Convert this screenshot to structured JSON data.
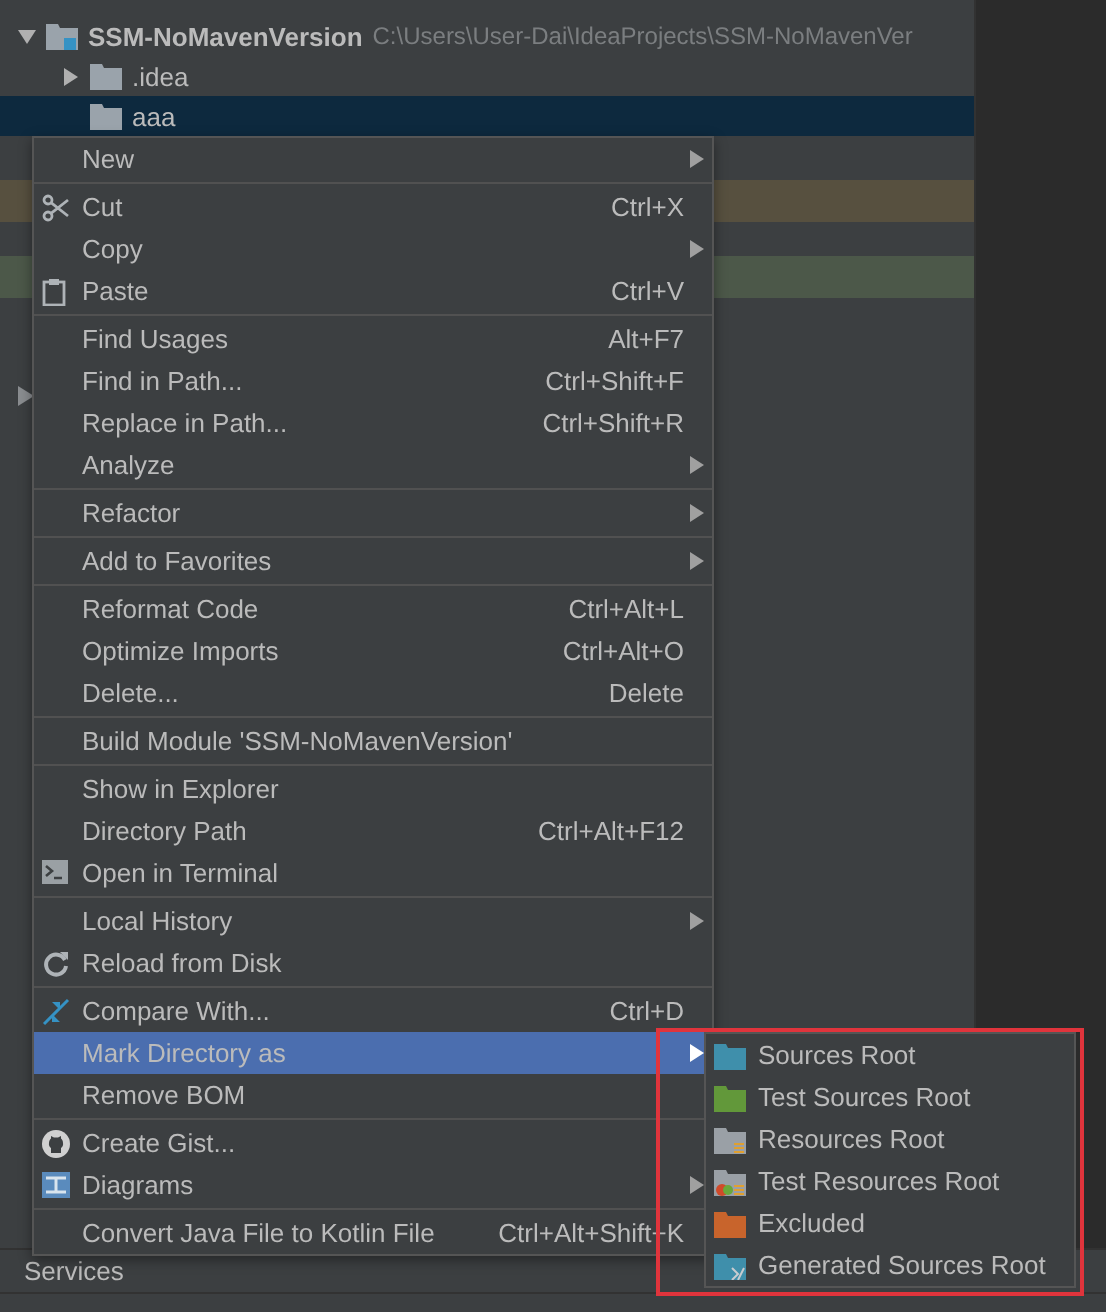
{
  "project_tree": {
    "items": [
      {
        "name": "SSM-NoMavenVersion",
        "path": "C:\\Users\\User-Dai\\IdeaProjects\\SSM-NoMavenVer",
        "expanded": true,
        "selected": false,
        "children": [
          {
            "name": ".idea",
            "expanded": false,
            "selected": false
          },
          {
            "name": "aaa",
            "selected": true
          }
        ]
      }
    ]
  },
  "context_menu": {
    "groups": [
      {
        "items": [
          {
            "label": "New",
            "submenu": true,
            "selected": false
          }
        ]
      },
      {
        "items": [
          {
            "label": "Cut",
            "shortcut": "Ctrl+X",
            "kind": "cut",
            "selected": false
          },
          {
            "label": "Copy",
            "submenu": true,
            "selected": false
          },
          {
            "label": "Paste",
            "shortcut": "Ctrl+V",
            "kind": "paste",
            "selected": false
          }
        ]
      },
      {
        "items": [
          {
            "label": "Find Usages",
            "shortcut": "Alt+F7",
            "selected": false
          },
          {
            "label": "Find in Path...",
            "shortcut": "Ctrl+Shift+F",
            "selected": false
          },
          {
            "label": "Replace in Path...",
            "shortcut": "Ctrl+Shift+R",
            "selected": false
          },
          {
            "label": "Analyze",
            "submenu": true,
            "selected": false
          }
        ]
      },
      {
        "items": [
          {
            "label": "Refactor",
            "submenu": true,
            "selected": false
          }
        ]
      },
      {
        "items": [
          {
            "label": "Add to Favorites",
            "submenu": true,
            "selected": false
          }
        ]
      },
      {
        "items": [
          {
            "label": "Reformat Code",
            "shortcut": "Ctrl+Alt+L",
            "selected": false
          },
          {
            "label": "Optimize Imports",
            "shortcut": "Ctrl+Alt+O",
            "selected": false
          },
          {
            "label": "Delete...",
            "shortcut": "Delete",
            "selected": false
          }
        ]
      },
      {
        "items": [
          {
            "label": "Build Module 'SSM-NoMavenVersion'",
            "selected": false
          }
        ]
      },
      {
        "items": [
          {
            "label": "Show in Explorer",
            "selected": false
          },
          {
            "label": "Directory Path",
            "shortcut": "Ctrl+Alt+F12",
            "selected": false
          },
          {
            "label": "Open in Terminal",
            "kind": "terminal",
            "selected": false
          }
        ]
      },
      {
        "items": [
          {
            "label": "Local History",
            "submenu": true,
            "selected": false
          },
          {
            "label": "Reload from Disk",
            "kind": "reload",
            "selected": false
          }
        ]
      },
      {
        "items": [
          {
            "label": "Compare With...",
            "shortcut": "Ctrl+D",
            "kind": "compare",
            "selected": false
          },
          {
            "label": "Mark Directory as",
            "submenu": true,
            "selected": true
          },
          {
            "label": "Remove BOM",
            "selected": false
          }
        ]
      },
      {
        "items": [
          {
            "label": "Create Gist...",
            "kind": "github",
            "selected": false
          },
          {
            "label": "Diagrams",
            "submenu": true,
            "kind": "diagram",
            "selected": false
          }
        ]
      },
      {
        "items": [
          {
            "label": "Convert Java File to Kotlin File",
            "shortcut": "Ctrl+Alt+Shift+K",
            "selected": false
          }
        ]
      }
    ]
  },
  "mark_directory_submenu": {
    "items": [
      {
        "label": "Sources Root",
        "kind": "sources"
      },
      {
        "label": "Test Sources Root",
        "kind": "test-sources"
      },
      {
        "label": "Resources Root",
        "kind": "resources"
      },
      {
        "label": "Test Resources Root",
        "kind": "test-resources"
      },
      {
        "label": "Excluded",
        "kind": "excluded"
      },
      {
        "label": "Generated Sources Root",
        "kind": "generated"
      }
    ]
  },
  "bottom_panel": {
    "title": "Services"
  }
}
